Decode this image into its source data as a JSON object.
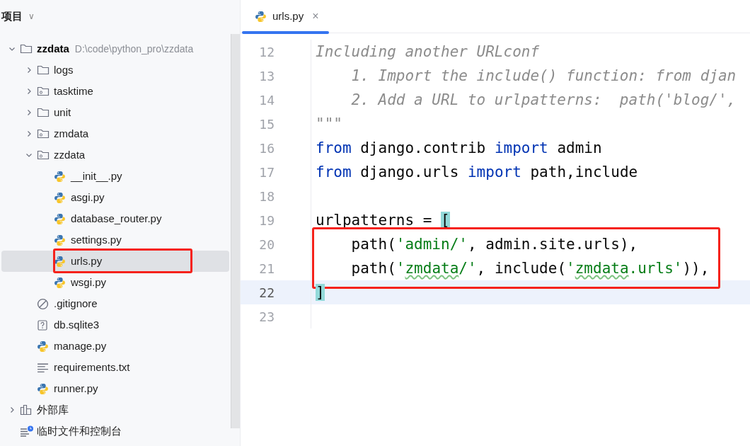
{
  "panel": {
    "title": "项目",
    "caret": "∨"
  },
  "tree": [
    {
      "kind": "project",
      "label": "zzdata",
      "path": "D:\\code\\python_pro\\zzdata",
      "expanded": true,
      "selected": false,
      "children": [
        {
          "kind": "folder",
          "label": "logs",
          "expanded": false,
          "selected": false
        },
        {
          "kind": "package",
          "label": "tasktime",
          "expanded": false,
          "selected": false
        },
        {
          "kind": "folder",
          "label": "unit",
          "expanded": false,
          "selected": false
        },
        {
          "kind": "package",
          "label": "zmdata",
          "expanded": false,
          "selected": false
        },
        {
          "kind": "package",
          "label": "zzdata",
          "expanded": true,
          "selected": false,
          "children": [
            {
              "kind": "python",
              "label": "__init__.py",
              "selected": false
            },
            {
              "kind": "python",
              "label": "asgi.py",
              "selected": false
            },
            {
              "kind": "python",
              "label": "database_router.py",
              "selected": false
            },
            {
              "kind": "python",
              "label": "settings.py",
              "selected": false
            },
            {
              "kind": "python",
              "label": "urls.py",
              "selected": true,
              "annotated": true
            },
            {
              "kind": "python",
              "label": "wsgi.py",
              "selected": false
            }
          ]
        },
        {
          "kind": "ignore",
          "label": ".gitignore",
          "selected": false
        },
        {
          "kind": "unknown",
          "label": "db.sqlite3",
          "selected": false
        },
        {
          "kind": "python",
          "label": "manage.py",
          "selected": false
        },
        {
          "kind": "text",
          "label": "requirements.txt",
          "selected": false
        },
        {
          "kind": "python",
          "label": "runner.py",
          "selected": false
        }
      ]
    },
    {
      "kind": "library",
      "label": "外部库",
      "expanded": false,
      "selected": false
    },
    {
      "kind": "scratch",
      "label": "临时文件和控制台",
      "selected": false
    }
  ],
  "tabs": [
    {
      "label": "urls.py",
      "close": "×",
      "selected": true
    }
  ],
  "editor": {
    "lines": [
      {
        "number": "12",
        "current": false,
        "annotated": false,
        "tokens": [
          {
            "kind": "comment",
            "text": "Including another URLconf"
          }
        ]
      },
      {
        "number": "13",
        "current": false,
        "annotated": false,
        "tokens": [
          {
            "kind": "comment",
            "text": "    1. Import the include() function: from djan"
          }
        ]
      },
      {
        "number": "14",
        "current": false,
        "annotated": false,
        "tokens": [
          {
            "kind": "comment",
            "text": "    2. Add a URL to urlpatterns:  path('blog/',"
          }
        ]
      },
      {
        "number": "15",
        "current": false,
        "annotated": false,
        "tokens": [
          {
            "kind": "comment",
            "text": "\"\"\""
          }
        ]
      },
      {
        "number": "16",
        "current": false,
        "annotated": false,
        "tokens": [
          {
            "kind": "keyword",
            "text": "from"
          },
          {
            "kind": "plain",
            "text": " django.contrib "
          },
          {
            "kind": "keyword",
            "text": "import"
          },
          {
            "kind": "plain",
            "text": " admin"
          }
        ]
      },
      {
        "number": "17",
        "current": false,
        "annotated": false,
        "tokens": [
          {
            "kind": "keyword",
            "text": "from"
          },
          {
            "kind": "plain",
            "text": " django.urls "
          },
          {
            "kind": "keyword",
            "text": "import"
          },
          {
            "kind": "plain",
            "text": " path,include"
          }
        ]
      },
      {
        "number": "18",
        "current": false,
        "annotated": false
      },
      {
        "number": "19",
        "current": false,
        "annotated": false,
        "tokens": [
          {
            "kind": "plain",
            "text": "urlpatterns = "
          },
          {
            "kind": "match",
            "text": "["
          }
        ]
      },
      {
        "number": "20",
        "current": false,
        "annotated": true,
        "tokens": [
          {
            "kind": "plain",
            "text": "    path("
          },
          {
            "kind": "string",
            "text": "'admin/'"
          },
          {
            "kind": "plain",
            "text": ", admin.site.urls),"
          }
        ]
      },
      {
        "number": "21",
        "current": false,
        "annotated": true,
        "tokens": [
          {
            "kind": "plain",
            "text": "    path("
          },
          {
            "kind": "string",
            "text": "'"
          },
          {
            "kind": "typo",
            "text": "zmdata"
          },
          {
            "kind": "string",
            "text": "/'"
          },
          {
            "kind": "plain",
            "text": ", include("
          },
          {
            "kind": "string",
            "text": "'"
          },
          {
            "kind": "typo",
            "text": "zmdata"
          },
          {
            "kind": "string",
            "text": ".urls'"
          },
          {
            "kind": "plain",
            "text": ")),"
          }
        ]
      },
      {
        "number": "22",
        "current": true,
        "annotated": false,
        "tokens": [
          {
            "kind": "match",
            "text": "]"
          }
        ]
      },
      {
        "number": "23",
        "current": false,
        "annotated": false
      }
    ]
  }
}
